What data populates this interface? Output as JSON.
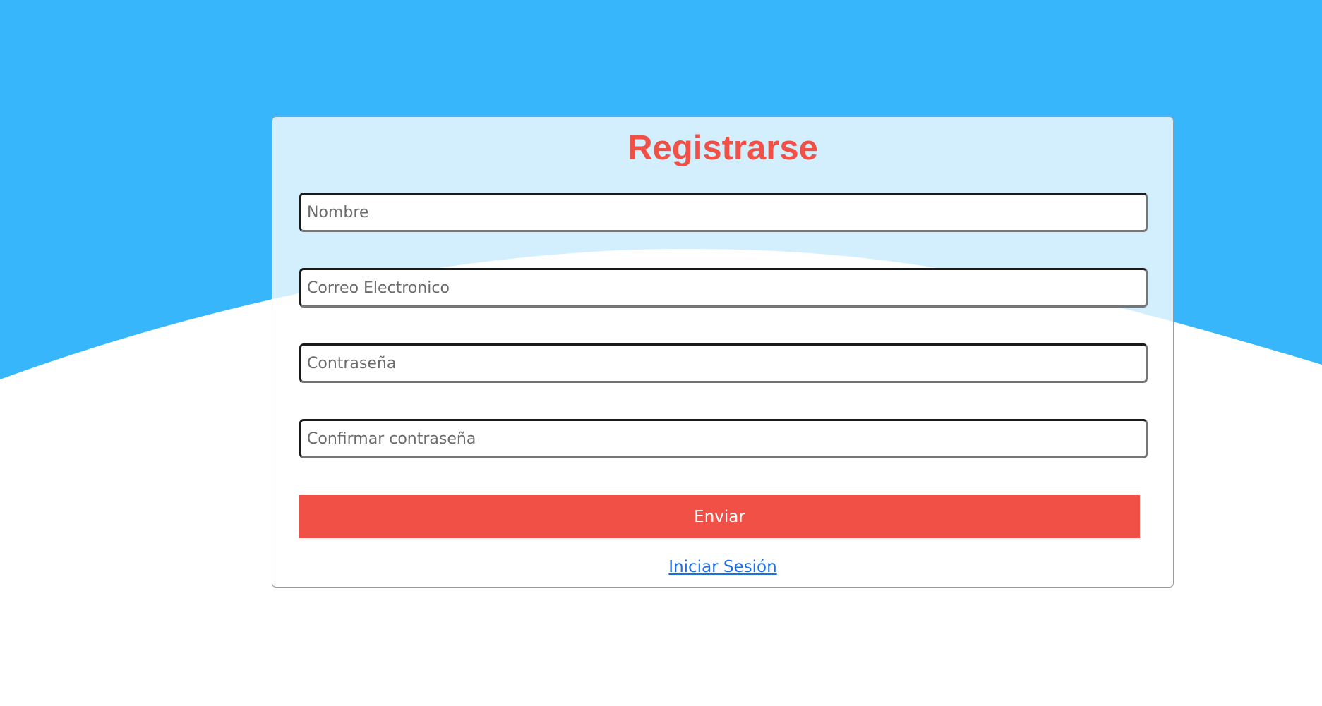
{
  "theme": {
    "background_top": "#37b6fb",
    "background_bottom": "#ffffff",
    "accent": "#f15046",
    "link_color": "#1a6ee6"
  },
  "form": {
    "title": "Registrarse",
    "fields": {
      "nombre": {
        "placeholder": "Nombre",
        "value": ""
      },
      "correo": {
        "placeholder": "Correo Electronico",
        "value": ""
      },
      "password": {
        "placeholder": "Contraseña",
        "value": ""
      },
      "confirm_password": {
        "placeholder": "Confirmar contraseña",
        "value": ""
      }
    },
    "submit_label": "Enviar",
    "login_link_label": "Iniciar Sesión"
  }
}
